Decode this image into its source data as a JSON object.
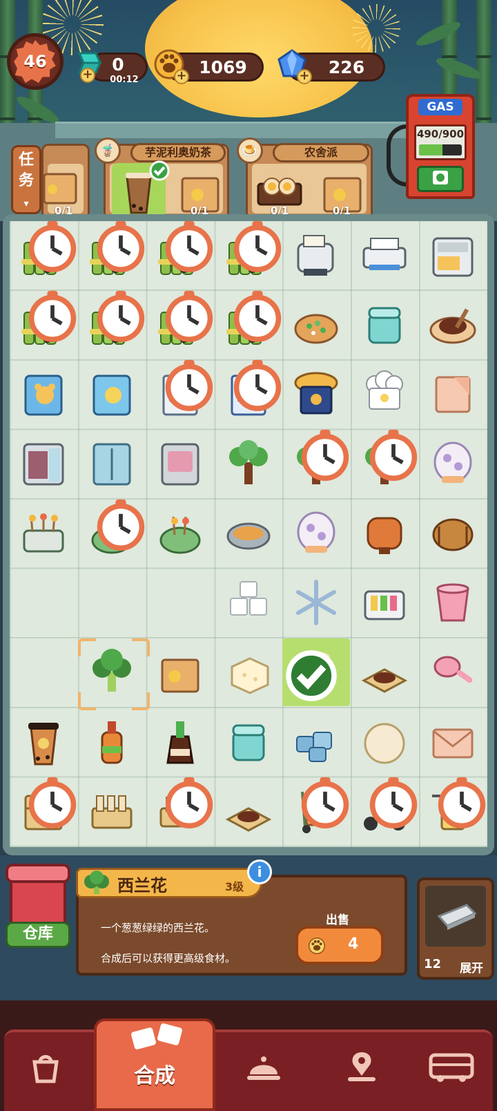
{
  "hud": {
    "level": "46",
    "energy": {
      "value": "0",
      "timer": "00:12"
    },
    "paws": {
      "value": "1069"
    },
    "gems": {
      "value": "226"
    }
  },
  "gas": {
    "label": "GAS",
    "value": "490/900",
    "fill_fraction": 0.544
  },
  "tasks_tab": {
    "label": "任务"
  },
  "orders": [
    {
      "title": "",
      "counts": [
        "0/1"
      ]
    },
    {
      "title": "芋泥利奥奶茶",
      "counts": [
        "",
        "0/1"
      ]
    },
    {
      "title": "农舍派",
      "counts": [
        "0/1",
        "0/1"
      ]
    }
  ],
  "board": {
    "columns": 7,
    "rows": 9,
    "cells": [
      {
        "item": "bamboo-bundle",
        "timer": true
      },
      {
        "item": "bamboo-bundle",
        "timer": true
      },
      {
        "item": "bamboo-bundle",
        "timer": true
      },
      {
        "item": "bamboo-bundle",
        "timer": true
      },
      {
        "item": "toaster"
      },
      {
        "item": "printer"
      },
      {
        "item": "copier"
      },
      {
        "item": "bamboo-bundle",
        "timer": true
      },
      {
        "item": "bamboo-bundle",
        "timer": true
      },
      {
        "item": "bamboo-bundle",
        "timer": true
      },
      {
        "item": "bamboo-bundle",
        "timer": true
      },
      {
        "item": "scallion-toast"
      },
      {
        "item": "jar-mint"
      },
      {
        "item": "noodle-plate"
      },
      {
        "item": "notebook-bear"
      },
      {
        "item": "notebook-sun"
      },
      {
        "item": "notepad",
        "timer": true
      },
      {
        "item": "notepad-blue",
        "timer": true
      },
      {
        "item": "chef-hat-gold"
      },
      {
        "item": "chef-hat-white"
      },
      {
        "item": "paper-sheet"
      },
      {
        "item": "fridge-open"
      },
      {
        "item": "cabinet-blue"
      },
      {
        "item": "locker"
      },
      {
        "item": "tree"
      },
      {
        "item": "tree",
        "timer": true
      },
      {
        "item": "tree",
        "timer": true
      },
      {
        "item": "egg-cup"
      },
      {
        "item": "oden-cart"
      },
      {
        "item": "oden-pot",
        "timer": true
      },
      {
        "item": "oden-pot"
      },
      {
        "item": "soup-pot"
      },
      {
        "item": "egg-cup"
      },
      {
        "item": "barrel-orange"
      },
      {
        "item": "barrel-wood"
      },
      {
        "item": ""
      },
      {
        "item": ""
      },
      {
        "item": ""
      },
      {
        "item": "tofu-cubes"
      },
      {
        "item": "snowflake"
      },
      {
        "item": "syrup-dispenser"
      },
      {
        "item": "pink-bucket"
      },
      {
        "item": ""
      },
      {
        "item": "broccoli",
        "selected": true
      },
      {
        "item": "takeout-bag"
      },
      {
        "item": "tofu"
      },
      {
        "item": "milk-tea",
        "done": true
      },
      {
        "item": "noodle-mat"
      },
      {
        "item": "pink-brush"
      },
      {
        "item": "bubble-tea"
      },
      {
        "item": "sauce-bottle"
      },
      {
        "item": "soy-bottle"
      },
      {
        "item": "jar-mint"
      },
      {
        "item": "puzzle-pieces"
      },
      {
        "item": "dough-ball"
      },
      {
        "item": "envelope"
      },
      {
        "item": "shelf-cart",
        "timer": true
      },
      {
        "item": "bottle-rack"
      },
      {
        "item": "bottle-tray",
        "timer": true
      },
      {
        "item": "noodle-mat"
      },
      {
        "item": "hand-truck",
        "timer": true
      },
      {
        "item": "scooter",
        "timer": true
      },
      {
        "item": "drone-box",
        "timer": true
      }
    ]
  },
  "info": {
    "name": "西兰花",
    "level": "3级",
    "info_glyph": "i",
    "desc1": "一个葱葱绿绿的西兰花。",
    "desc2": "合成后可以获得更高级食材。",
    "sell_label": "出售",
    "sell_price": "4"
  },
  "warehouse": {
    "label": "仓库"
  },
  "expand": {
    "count": "12",
    "label": "展开"
  },
  "nav": {
    "active_label": "合成",
    "items": [
      "bag-icon",
      "merge-icon",
      "service-bell-icon",
      "map-pin-icon",
      "bus-icon"
    ]
  },
  "colors": {
    "accent": "#e86a4a",
    "board": "#dfe9dd",
    "nav": "#7a1f23",
    "check": "#b6de6f"
  }
}
